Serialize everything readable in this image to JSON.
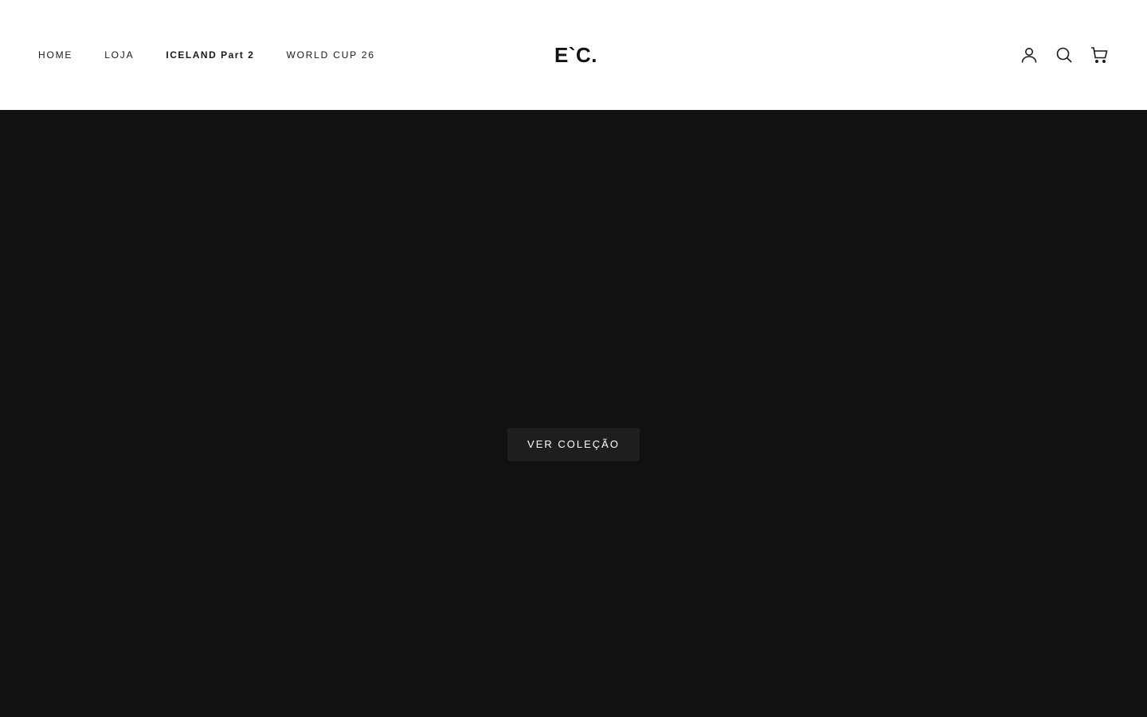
{
  "header": {
    "nav": [
      {
        "label": "HOME"
      },
      {
        "label": "LOJA"
      },
      {
        "label": "ICELAND Part 2"
      },
      {
        "label": "WORLD CUP 26"
      }
    ],
    "logo": "E`C.",
    "icons": [
      "account-icon",
      "search-icon",
      "cart-icon"
    ]
  },
  "hero": {
    "cta_label": "VER COLEÇÃO"
  },
  "colors": {
    "header_bg": "#ffffff",
    "hero_bg": "#111111",
    "cta_bg": "#1e1e1e",
    "text": "#1a1a1a"
  }
}
